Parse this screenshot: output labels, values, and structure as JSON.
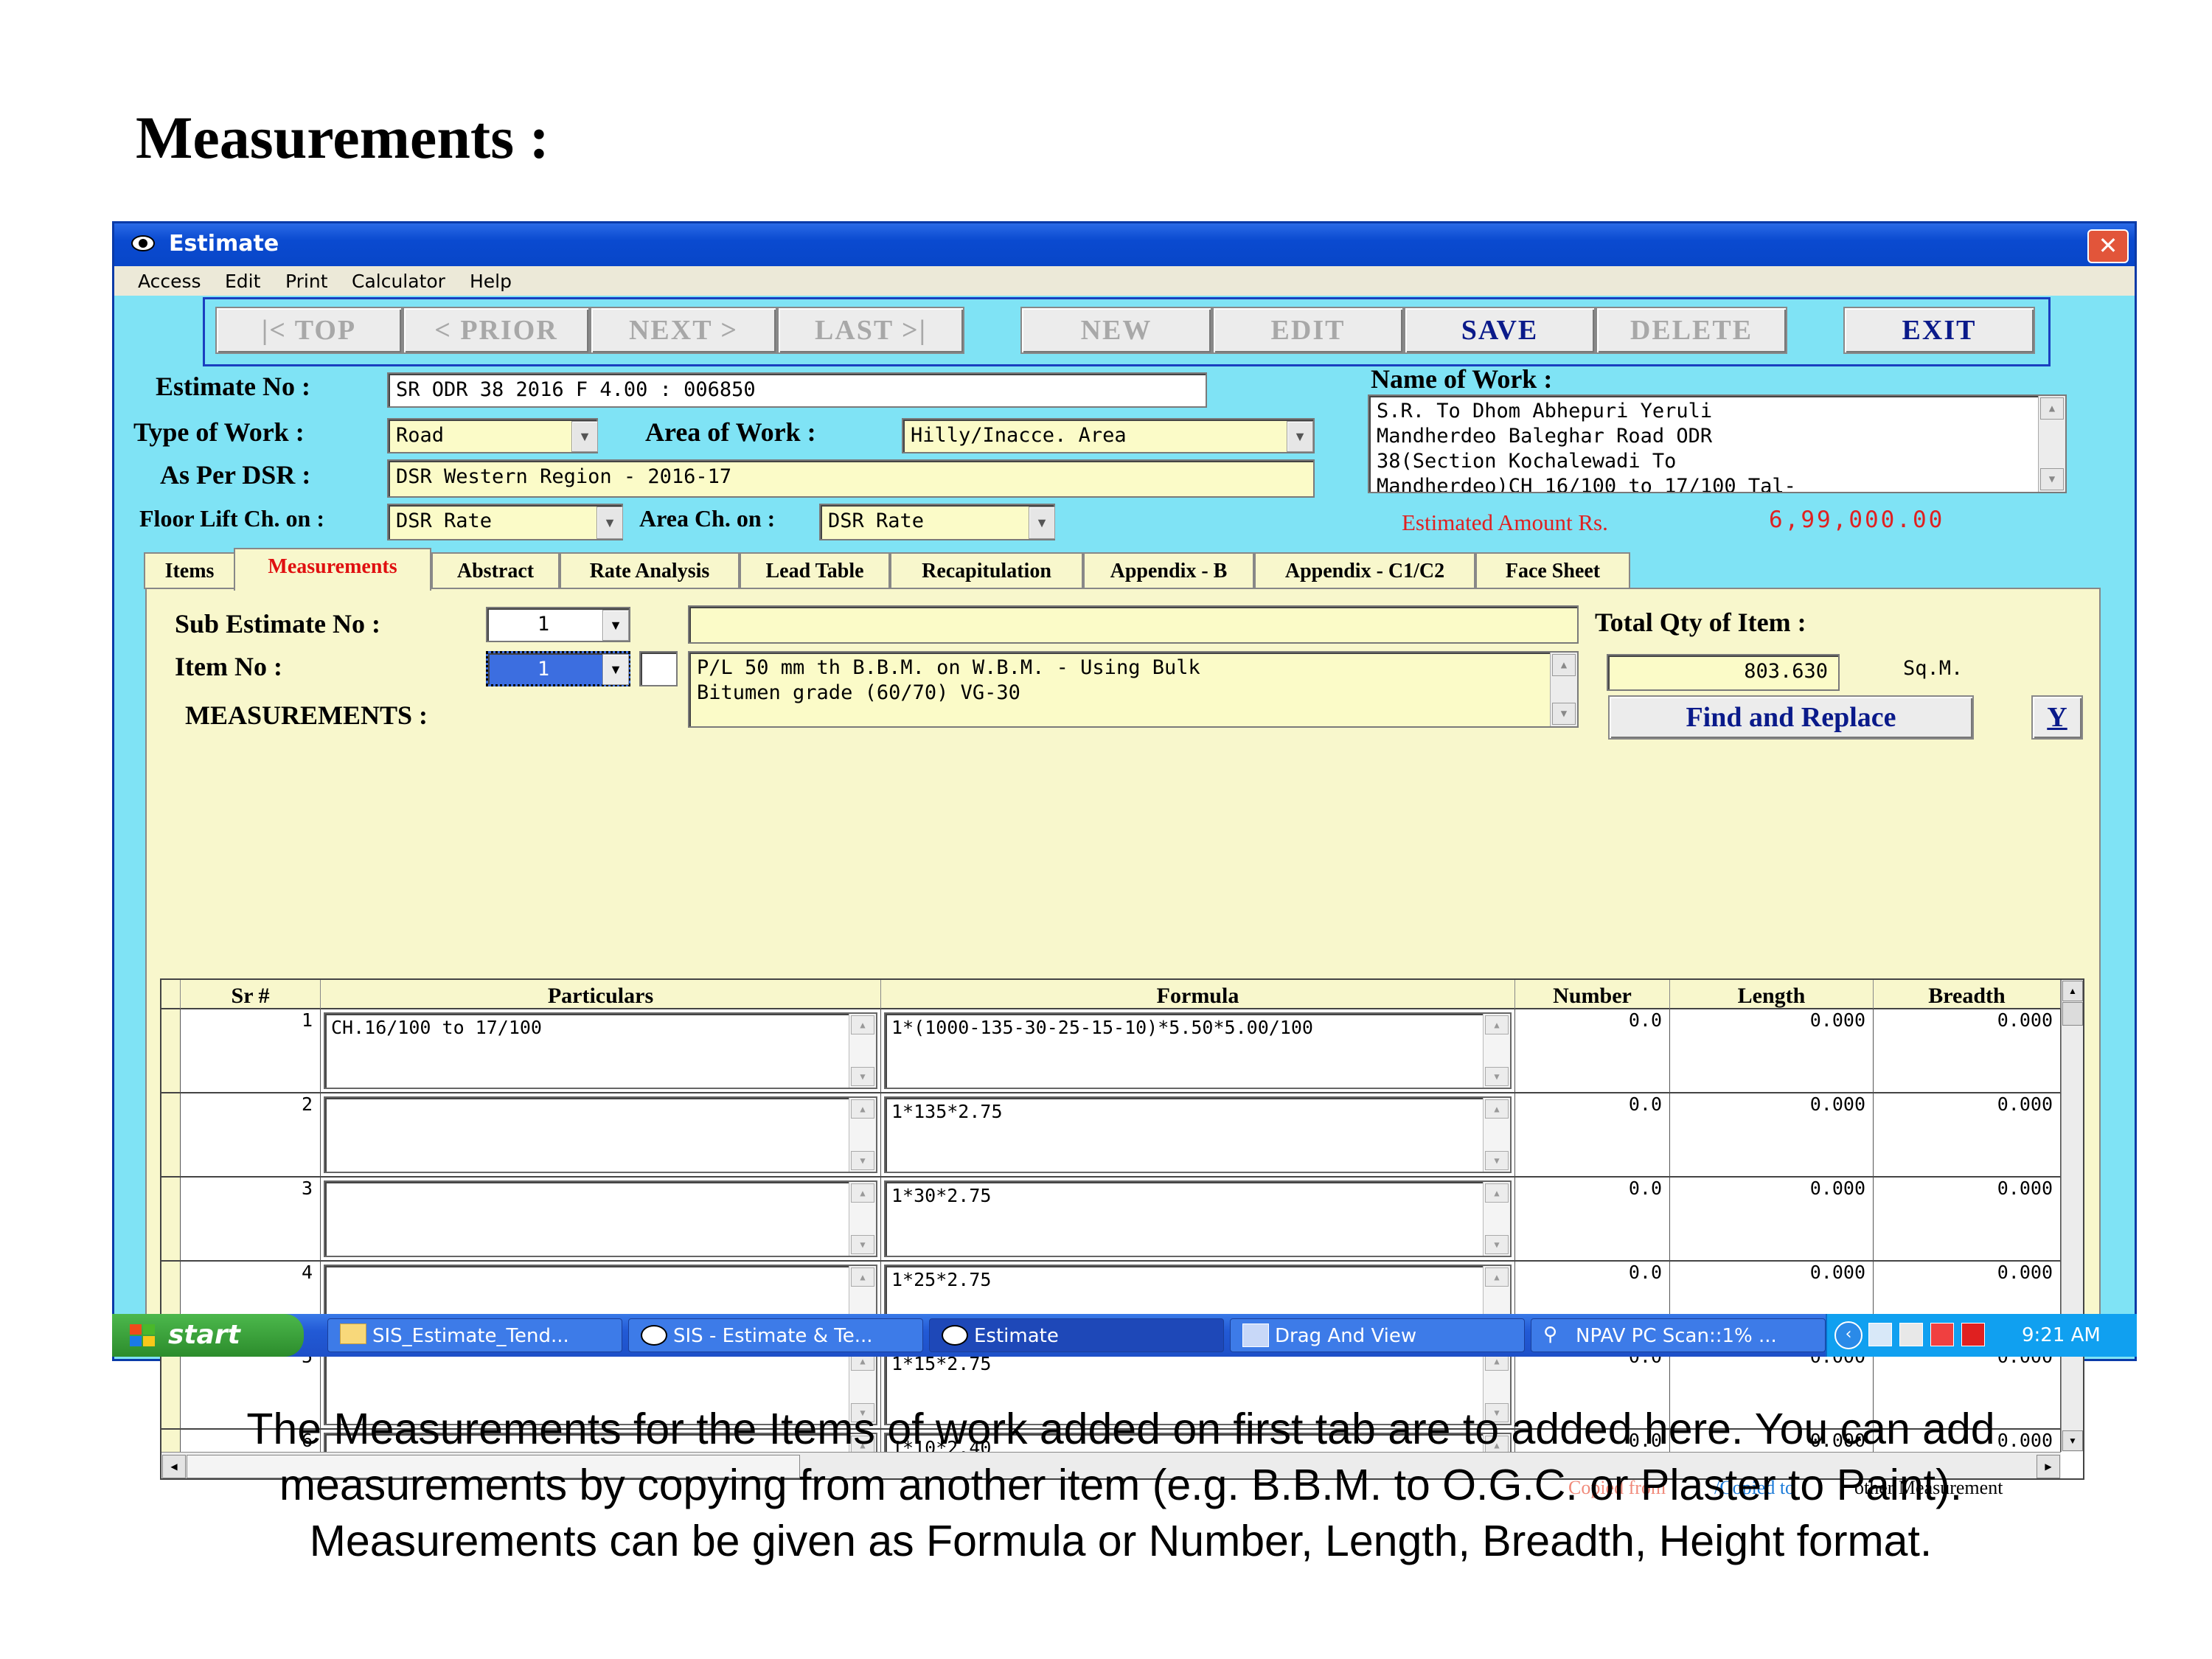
{
  "page_title": "Measurements :",
  "caption": {
    "line1": "The Measurements for the Items of work added on first tab are to added here. You can add",
    "line2": "measurements by copying from another item (e.g. B.B.M. to O.G.C. or Plaster to Paint).",
    "line3": "Measurements can be given as Formula or Number, Length, Breadth, Height format."
  },
  "window": {
    "title": "Estimate",
    "close": "✕"
  },
  "menu": [
    "Access",
    "Edit",
    "Print",
    "Calculator",
    "Help"
  ],
  "nav_buttons": {
    "top": "|< TOP",
    "prior": "< PRIOR",
    "next": "NEXT >",
    "last": "LAST >|",
    "new": "NEW",
    "edit": "EDIT",
    "save": "SAVE",
    "delete": "DELETE",
    "exit": "EXIT"
  },
  "form": {
    "estimate_no_label": "Estimate No :",
    "estimate_no": "SR ODR 38 2016 F 4.00 : 006850",
    "type_of_work_label": "Type of Work :",
    "type_of_work": "Road",
    "area_of_work_label": "Area of Work :",
    "area_of_work": "Hilly/Inacce. Area",
    "as_per_dsr_label": "As Per DSR :",
    "as_per_dsr": "DSR Western Region - 2016-17",
    "floor_lift_label": "Floor Lift Ch. on :",
    "floor_lift": "DSR Rate",
    "area_ch_label": "Area Ch. on :",
    "area_ch": "DSR Rate",
    "name_of_work_label": "Name of Work :",
    "name_of_work_lines": [
      "S.R. To Dhom Abhepuri Yeruli",
      "Mandherdeo Baleghar Road ODR",
      "38(Section Kochalewadi To",
      "Mandherdeo)CH 16/100 to 17/100 Tal-"
    ],
    "estimated_amount_label": "Estimated Amount Rs.",
    "estimated_amount": "6,99,000.00"
  },
  "tabs": [
    "Items",
    "Measurements",
    "Abstract",
    "Rate Analysis",
    "Lead Table",
    "Recapitulation",
    "Appendix - B",
    "Appendix - C1/C2",
    "Face Sheet"
  ],
  "measure": {
    "sub_estimate_label": "Sub Estimate No :",
    "sub_estimate_no": "1",
    "item_no_label": "Item No :",
    "item_no": "1",
    "measurements_label": "MEASUREMENTS :",
    "item_desc_lines": [
      "P/L 50 mm th B.B.M. on W.B.M. - Using Bulk",
      "Bitumen grade (60/70) VG-30"
    ],
    "total_qty_label": "Total Qty of  Item :",
    "total_qty": "803.630",
    "unit": "Sq.M.",
    "find_replace": "Find and Replace",
    "y_button": "Y"
  },
  "grid": {
    "columns": [
      "Sr #",
      "Particulars",
      "Formula",
      "Number",
      "Length",
      "Breadth"
    ],
    "rows": [
      {
        "sr": "1",
        "particulars": "CH.16/100 to 17/100",
        "formula": "1*(1000-135-30-25-15-10)*5.50*5.00/100",
        "number": "0.0",
        "length": "0.000",
        "breadth": "0.000"
      },
      {
        "sr": "2",
        "particulars": "",
        "formula": "1*135*2.75",
        "number": "0.0",
        "length": "0.000",
        "breadth": "0.000"
      },
      {
        "sr": "3",
        "particulars": "",
        "formula": "1*30*2.75",
        "number": "0.0",
        "length": "0.000",
        "breadth": "0.000"
      },
      {
        "sr": "4",
        "particulars": "",
        "formula": "1*25*2.75",
        "number": "0.0",
        "length": "0.000",
        "breadth": "0.000"
      },
      {
        "sr": "5",
        "particulars": "",
        "formula": "1*15*2.75",
        "number": "0.0",
        "length": "0.000",
        "breadth": "0.000"
      },
      {
        "sr": "6",
        "particulars": "",
        "formula": "1*10*2.40",
        "number": "0.0",
        "length": "0.000",
        "breadth": "0.000"
      }
    ]
  },
  "copy_note": {
    "from": "Copied from",
    "to": "/Copied to",
    "other": "other Measurement"
  },
  "taskbar": {
    "start": "start",
    "tasks": [
      "SIS_Estimate_Tend...",
      "SIS - Estimate & Te...",
      "Estimate",
      "Drag And View",
      "NPAV PC Scan::1% ..."
    ],
    "clock": "9:21 AM"
  }
}
